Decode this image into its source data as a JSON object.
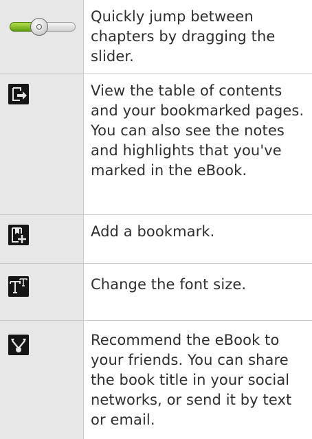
{
  "rows": [
    {
      "icon": "slider-icon",
      "text": "Quickly jump between chapters by dragging the slider."
    },
    {
      "icon": "table-of-contents-icon",
      "text": "View the table of contents and your bookmarked pages. You can also see the notes and highlights that you've marked in the eBook."
    },
    {
      "icon": "add-bookmark-icon",
      "text": "Add a bookmark."
    },
    {
      "icon": "font-size-icon",
      "text": "Change the font size."
    },
    {
      "icon": "recommend-share-icon",
      "text": "Recommend the eBook to your friends. You can share the book title in your social networks, or send it by text or email."
    }
  ]
}
